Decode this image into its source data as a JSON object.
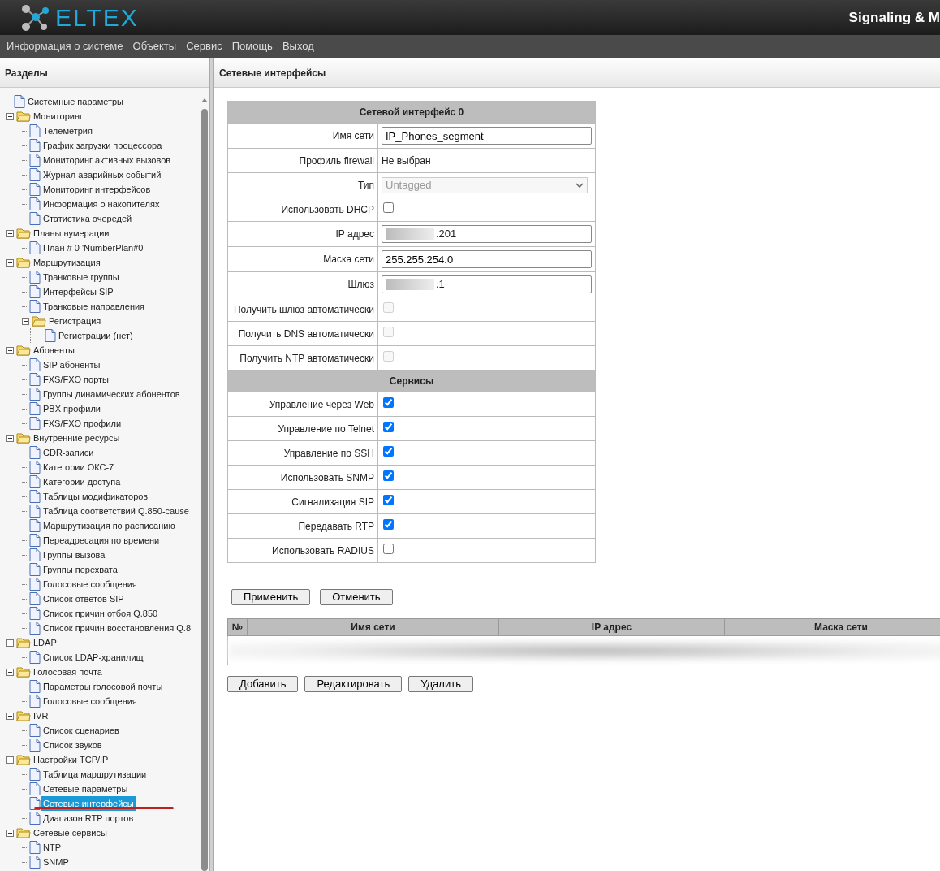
{
  "header": {
    "logo": "ELTEX",
    "product": "Signaling & M"
  },
  "menu": [
    "Информация о системе",
    "Объекты",
    "Сервис",
    "Помощь",
    "Выход"
  ],
  "sidebar": {
    "title": "Разделы",
    "items": [
      {
        "kind": "page",
        "label": "Системные параметры",
        "selected": false
      },
      {
        "kind": "folder",
        "label": "Мониторинг",
        "expanded": true,
        "selected": false,
        "children": [
          {
            "kind": "page",
            "label": "Телеметрия",
            "selected": false
          },
          {
            "kind": "page",
            "label": "График загрузки процессора",
            "selected": false
          },
          {
            "kind": "page",
            "label": "Мониторинг активных вызовов",
            "selected": false
          },
          {
            "kind": "page",
            "label": "Журнал аварийных событий",
            "selected": false
          },
          {
            "kind": "page",
            "label": "Мониторинг интерфейсов",
            "selected": false
          },
          {
            "kind": "page",
            "label": "Информация о накопителях",
            "selected": false
          },
          {
            "kind": "page",
            "label": "Статистика очередей",
            "selected": false
          }
        ]
      },
      {
        "kind": "folder",
        "label": "Планы нумерации",
        "expanded": true,
        "selected": false,
        "children": [
          {
            "kind": "page",
            "label": "План # 0 'NumberPlan#0'",
            "selected": false
          }
        ]
      },
      {
        "kind": "folder",
        "label": "Маршрутизация",
        "expanded": true,
        "selected": false,
        "children": [
          {
            "kind": "page",
            "label": "Транковые группы",
            "selected": false
          },
          {
            "kind": "page",
            "label": "Интерфейсы SIP",
            "selected": false
          },
          {
            "kind": "page",
            "label": "Транковые направления",
            "selected": false
          },
          {
            "kind": "folder",
            "label": "Регистрация",
            "expanded": true,
            "selected": false,
            "children": [
              {
                "kind": "page",
                "label": "Регистрации (нет)",
                "selected": false
              }
            ]
          }
        ]
      },
      {
        "kind": "folder",
        "label": "Абоненты",
        "expanded": true,
        "selected": false,
        "children": [
          {
            "kind": "page",
            "label": "SIP абоненты",
            "selected": false
          },
          {
            "kind": "page",
            "label": "FXS/FXO порты",
            "selected": false
          },
          {
            "kind": "page",
            "label": "Группы динамических абонентов",
            "selected": false
          },
          {
            "kind": "page",
            "label": "PBX профили",
            "selected": false
          },
          {
            "kind": "page",
            "label": "FXS/FXO профили",
            "selected": false
          }
        ]
      },
      {
        "kind": "folder",
        "label": "Внутренние ресурсы",
        "expanded": true,
        "selected": false,
        "children": [
          {
            "kind": "page",
            "label": "CDR-записи",
            "selected": false
          },
          {
            "kind": "page",
            "label": "Категории ОКС-7",
            "selected": false
          },
          {
            "kind": "page",
            "label": "Категории доступа",
            "selected": false
          },
          {
            "kind": "page",
            "label": "Таблицы модификаторов",
            "selected": false
          },
          {
            "kind": "page",
            "label": "Таблица соответствий Q.850-cause",
            "selected": false
          },
          {
            "kind": "page",
            "label": "Маршрутизация по расписанию",
            "selected": false
          },
          {
            "kind": "page",
            "label": "Переадресация по времени",
            "selected": false
          },
          {
            "kind": "page",
            "label": "Группы вызова",
            "selected": false
          },
          {
            "kind": "page",
            "label": "Группы перехвата",
            "selected": false
          },
          {
            "kind": "page",
            "label": "Голосовые сообщения",
            "selected": false
          },
          {
            "kind": "page",
            "label": "Список ответов SIP",
            "selected": false
          },
          {
            "kind": "page",
            "label": "Список причин отбоя Q.850",
            "selected": false
          },
          {
            "kind": "page",
            "label": "Список причин восстановления Q.8",
            "selected": false
          }
        ]
      },
      {
        "kind": "folder",
        "label": "LDAP",
        "expanded": true,
        "selected": false,
        "children": [
          {
            "kind": "page",
            "label": "Список LDAP-хранилищ",
            "selected": false
          }
        ]
      },
      {
        "kind": "folder",
        "label": "Голосовая почта",
        "expanded": true,
        "selected": false,
        "children": [
          {
            "kind": "page",
            "label": "Параметры голосовой почты",
            "selected": false
          },
          {
            "kind": "page",
            "label": "Голосовые сообщения",
            "selected": false
          }
        ]
      },
      {
        "kind": "folder",
        "label": "IVR",
        "expanded": true,
        "selected": false,
        "children": [
          {
            "kind": "page",
            "label": "Список сценариев",
            "selected": false
          },
          {
            "kind": "page",
            "label": "Список звуков",
            "selected": false
          }
        ]
      },
      {
        "kind": "folder",
        "label": "Настройки TCP/IP",
        "expanded": true,
        "selected": false,
        "children": [
          {
            "kind": "page",
            "label": "Таблица маршрутизации",
            "selected": false
          },
          {
            "kind": "page",
            "label": "Сетевые параметры",
            "selected": false
          },
          {
            "kind": "page",
            "label": "Сетевые интерфейсы",
            "selected": true
          },
          {
            "kind": "page",
            "label": "Диапазон RTP портов",
            "selected": false
          }
        ]
      },
      {
        "kind": "folder",
        "label": "Сетевые сервисы",
        "expanded": true,
        "selected": false,
        "children": [
          {
            "kind": "page",
            "label": "NTP",
            "selected": false
          },
          {
            "kind": "page",
            "label": "SNMP",
            "selected": false
          }
        ]
      }
    ]
  },
  "content": {
    "title": "Сетевые интерфейсы",
    "form": [
      {
        "kind": "section",
        "label": "Сетевой интерфейс 0"
      },
      {
        "kind": "text",
        "label": "Имя сети",
        "value": "IP_Phones_segment"
      },
      {
        "kind": "static",
        "label": "Профиль firewall",
        "value": "Не выбран"
      },
      {
        "kind": "select",
        "label": "Тип",
        "value": "Untagged",
        "disabled": true
      },
      {
        "kind": "checkbox",
        "label": "Использовать DHCP",
        "checked": false,
        "disabled": false
      },
      {
        "kind": "text",
        "label": "IP адрес",
        "value": ".201",
        "redacted": true
      },
      {
        "kind": "text",
        "label": "Маска сети",
        "value": "255.255.254.0"
      },
      {
        "kind": "text",
        "label": "Шлюз",
        "value": ".1",
        "redacted": true
      },
      {
        "kind": "checkbox",
        "label": "Получить шлюз автоматически",
        "checked": false,
        "disabled": true
      },
      {
        "kind": "checkbox",
        "label": "Получить DNS автоматически",
        "checked": false,
        "disabled": true
      },
      {
        "kind": "checkbox",
        "label": "Получить NTP автоматически",
        "checked": false,
        "disabled": true
      },
      {
        "kind": "section",
        "label": "Сервисы"
      },
      {
        "kind": "checkbox",
        "label": "Управление через Web",
        "checked": true,
        "disabled": false
      },
      {
        "kind": "checkbox",
        "label": "Управление по Telnet",
        "checked": true,
        "disabled": false
      },
      {
        "kind": "checkbox",
        "label": "Управление по SSH",
        "checked": true,
        "disabled": false
      },
      {
        "kind": "checkbox",
        "label": "Использовать SNMP",
        "checked": true,
        "disabled": false
      },
      {
        "kind": "checkbox",
        "label": "Сигнализация SIP",
        "checked": true,
        "disabled": false
      },
      {
        "kind": "checkbox",
        "label": "Передавать RTP",
        "checked": true,
        "disabled": false
      },
      {
        "kind": "checkbox",
        "label": "Использовать RADIUS",
        "checked": false,
        "disabled": false
      }
    ],
    "form_buttons": [
      "Применить",
      "Отменить"
    ],
    "table": {
      "columns": [
        "№",
        "Имя сети",
        "IP адрес",
        "Маска сети"
      ]
    },
    "table_buttons": [
      "Добавить",
      "Редактировать",
      "Удалить"
    ]
  }
}
